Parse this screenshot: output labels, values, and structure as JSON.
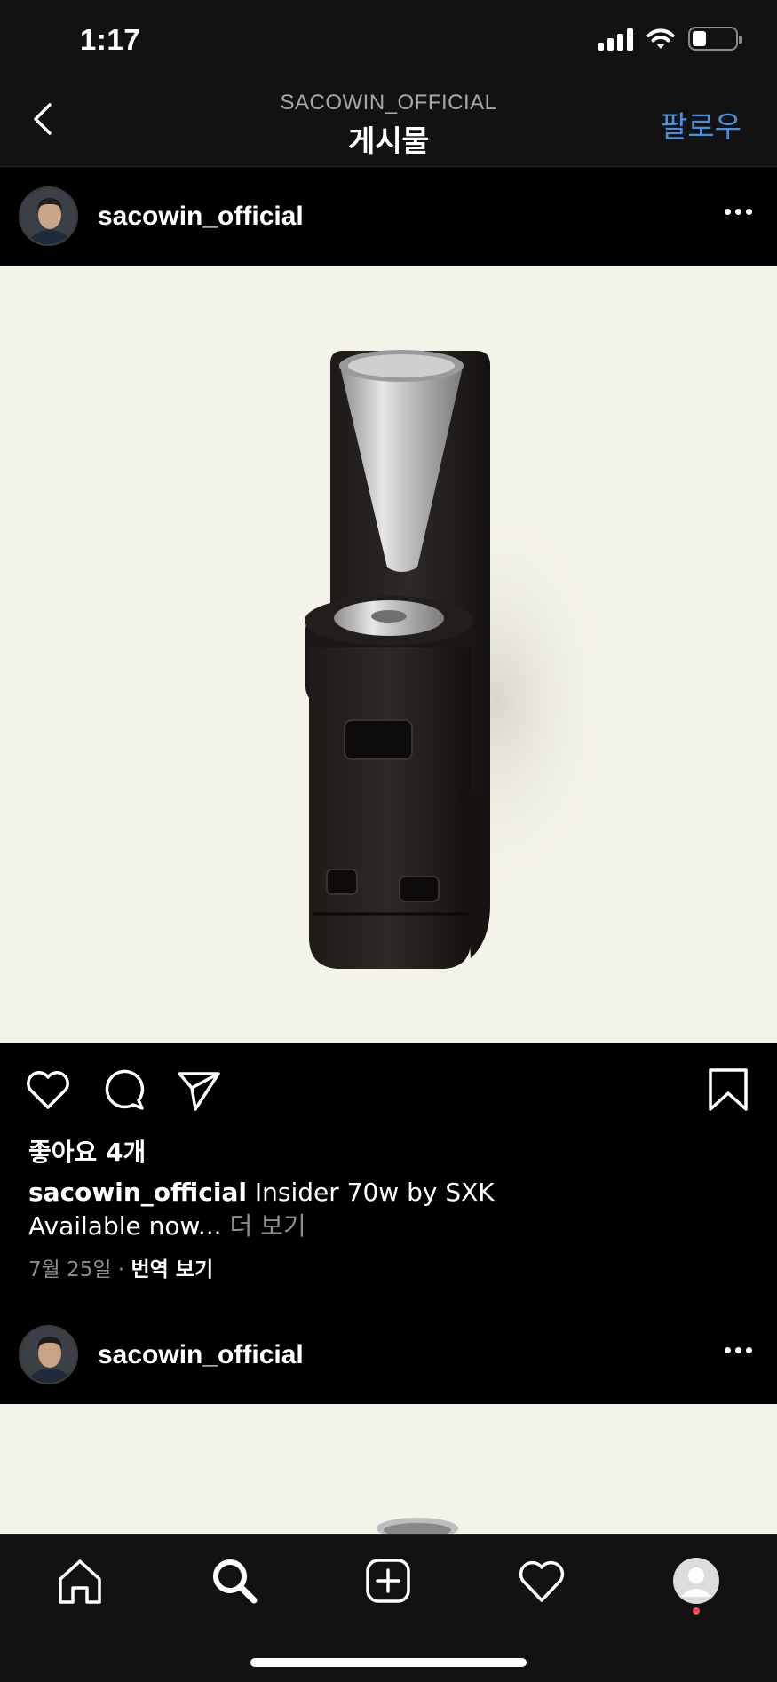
{
  "status_bar": {
    "time": "1:17",
    "icons": [
      "cellular-signal-icon",
      "wifi-icon",
      "battery-icon"
    ]
  },
  "header": {
    "subtitle": "SACOWIN_OFFICIAL",
    "title": "게시물",
    "follow_label": "팔로우",
    "accent_color": "#4a90d9"
  },
  "posts": [
    {
      "username": "sacowin_official",
      "likes": "좋아요 4개",
      "caption_user": "sacowin_official",
      "caption_line1": "Insider 70w by SXK",
      "caption_line2": "Available now...",
      "more_label": "더 보기",
      "date": "7월 25일",
      "separator": "·",
      "translate_label": "번역 보기"
    },
    {
      "username": "sacowin_official"
    }
  ],
  "tab_bar": {
    "items": [
      "home-icon",
      "search-icon",
      "create-post-icon",
      "activity-heart-icon",
      "profile-avatar"
    ],
    "active": "search-icon"
  }
}
